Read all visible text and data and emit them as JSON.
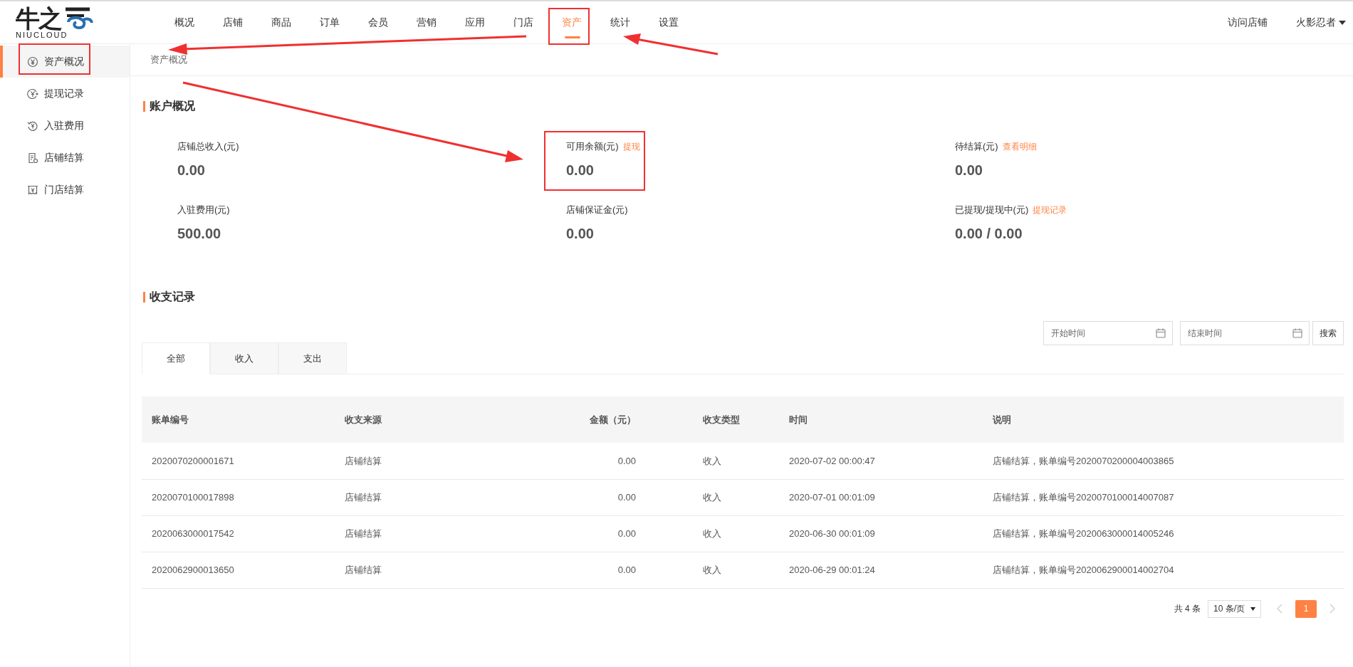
{
  "logo": {
    "mark": "牛之",
    "caption": "NIUCLOUD"
  },
  "nav": [
    {
      "label": "概况",
      "selected": false
    },
    {
      "label": "店铺",
      "selected": false
    },
    {
      "label": "商品",
      "selected": false
    },
    {
      "label": "订单",
      "selected": false
    },
    {
      "label": "会员",
      "selected": false
    },
    {
      "label": "营销",
      "selected": false
    },
    {
      "label": "应用",
      "selected": false
    },
    {
      "label": "门店",
      "selected": false
    },
    {
      "label": "资产",
      "selected": true
    },
    {
      "label": "统计",
      "selected": false
    },
    {
      "label": "设置",
      "selected": false
    }
  ],
  "header_links": {
    "visit_store": "访问店铺",
    "user": "火影忍者"
  },
  "sidebar": {
    "items": [
      {
        "label": "资产概况",
        "kind": "yen",
        "selected": true
      },
      {
        "label": "提现记录",
        "kind": "withdraw",
        "selected": false
      },
      {
        "label": "入驻费用",
        "kind": "refresh",
        "selected": false
      },
      {
        "label": "店铺结算",
        "kind": "receipt",
        "selected": false
      },
      {
        "label": "门店结算",
        "kind": "store",
        "selected": false
      }
    ]
  },
  "breadcrumb": "资产概况",
  "account": {
    "title": "账户概况",
    "stats": [
      {
        "label": "店铺总收入(元)",
        "value": "0.00"
      },
      {
        "label": "可用余额(元)",
        "link": "提现",
        "value": "0.00"
      },
      {
        "label": "待结算(元)",
        "link": "查看明细",
        "value": "0.00"
      },
      {
        "label": "入驻费用(元)",
        "value": "500.00"
      },
      {
        "label": "店铺保证金(元)",
        "value": "0.00"
      },
      {
        "label": "已提现/提现中(元)",
        "link": "提现记录",
        "value": "0.00 / 0.00"
      }
    ]
  },
  "records": {
    "title": "收支记录",
    "filters": {
      "start_placeholder": "开始时间",
      "end_placeholder": "结束时间",
      "search": "搜索"
    },
    "tabs": [
      {
        "label": "全部",
        "selected": true
      },
      {
        "label": "收入",
        "selected": false
      },
      {
        "label": "支出",
        "selected": false
      }
    ],
    "table": {
      "columns": [
        "账单编号",
        "收支来源",
        "金额（元）",
        "收支类型",
        "时间",
        "说明"
      ],
      "rows": [
        [
          "2020070200001671",
          "店铺结算",
          "0.00",
          "收入",
          "2020-07-02 00:00:47",
          "店铺结算，账单编号2020070200004003865"
        ],
        [
          "2020070100017898",
          "店铺结算",
          "0.00",
          "收入",
          "2020-07-01 00:01:09",
          "店铺结算，账单编号2020070100014007087"
        ],
        [
          "2020063000017542",
          "店铺结算",
          "0.00",
          "收入",
          "2020-06-30 00:01:09",
          "店铺结算，账单编号2020063000014005246"
        ],
        [
          "2020062900013650",
          "店铺结算",
          "0.00",
          "收入",
          "2020-06-29 00:01:24",
          "店铺结算，账单编号2020062900014002704"
        ]
      ]
    },
    "pagination": {
      "total": "共 4 条",
      "page_size": "10 条/页",
      "pages": [
        {
          "label": "1",
          "selected": true
        }
      ]
    }
  }
}
